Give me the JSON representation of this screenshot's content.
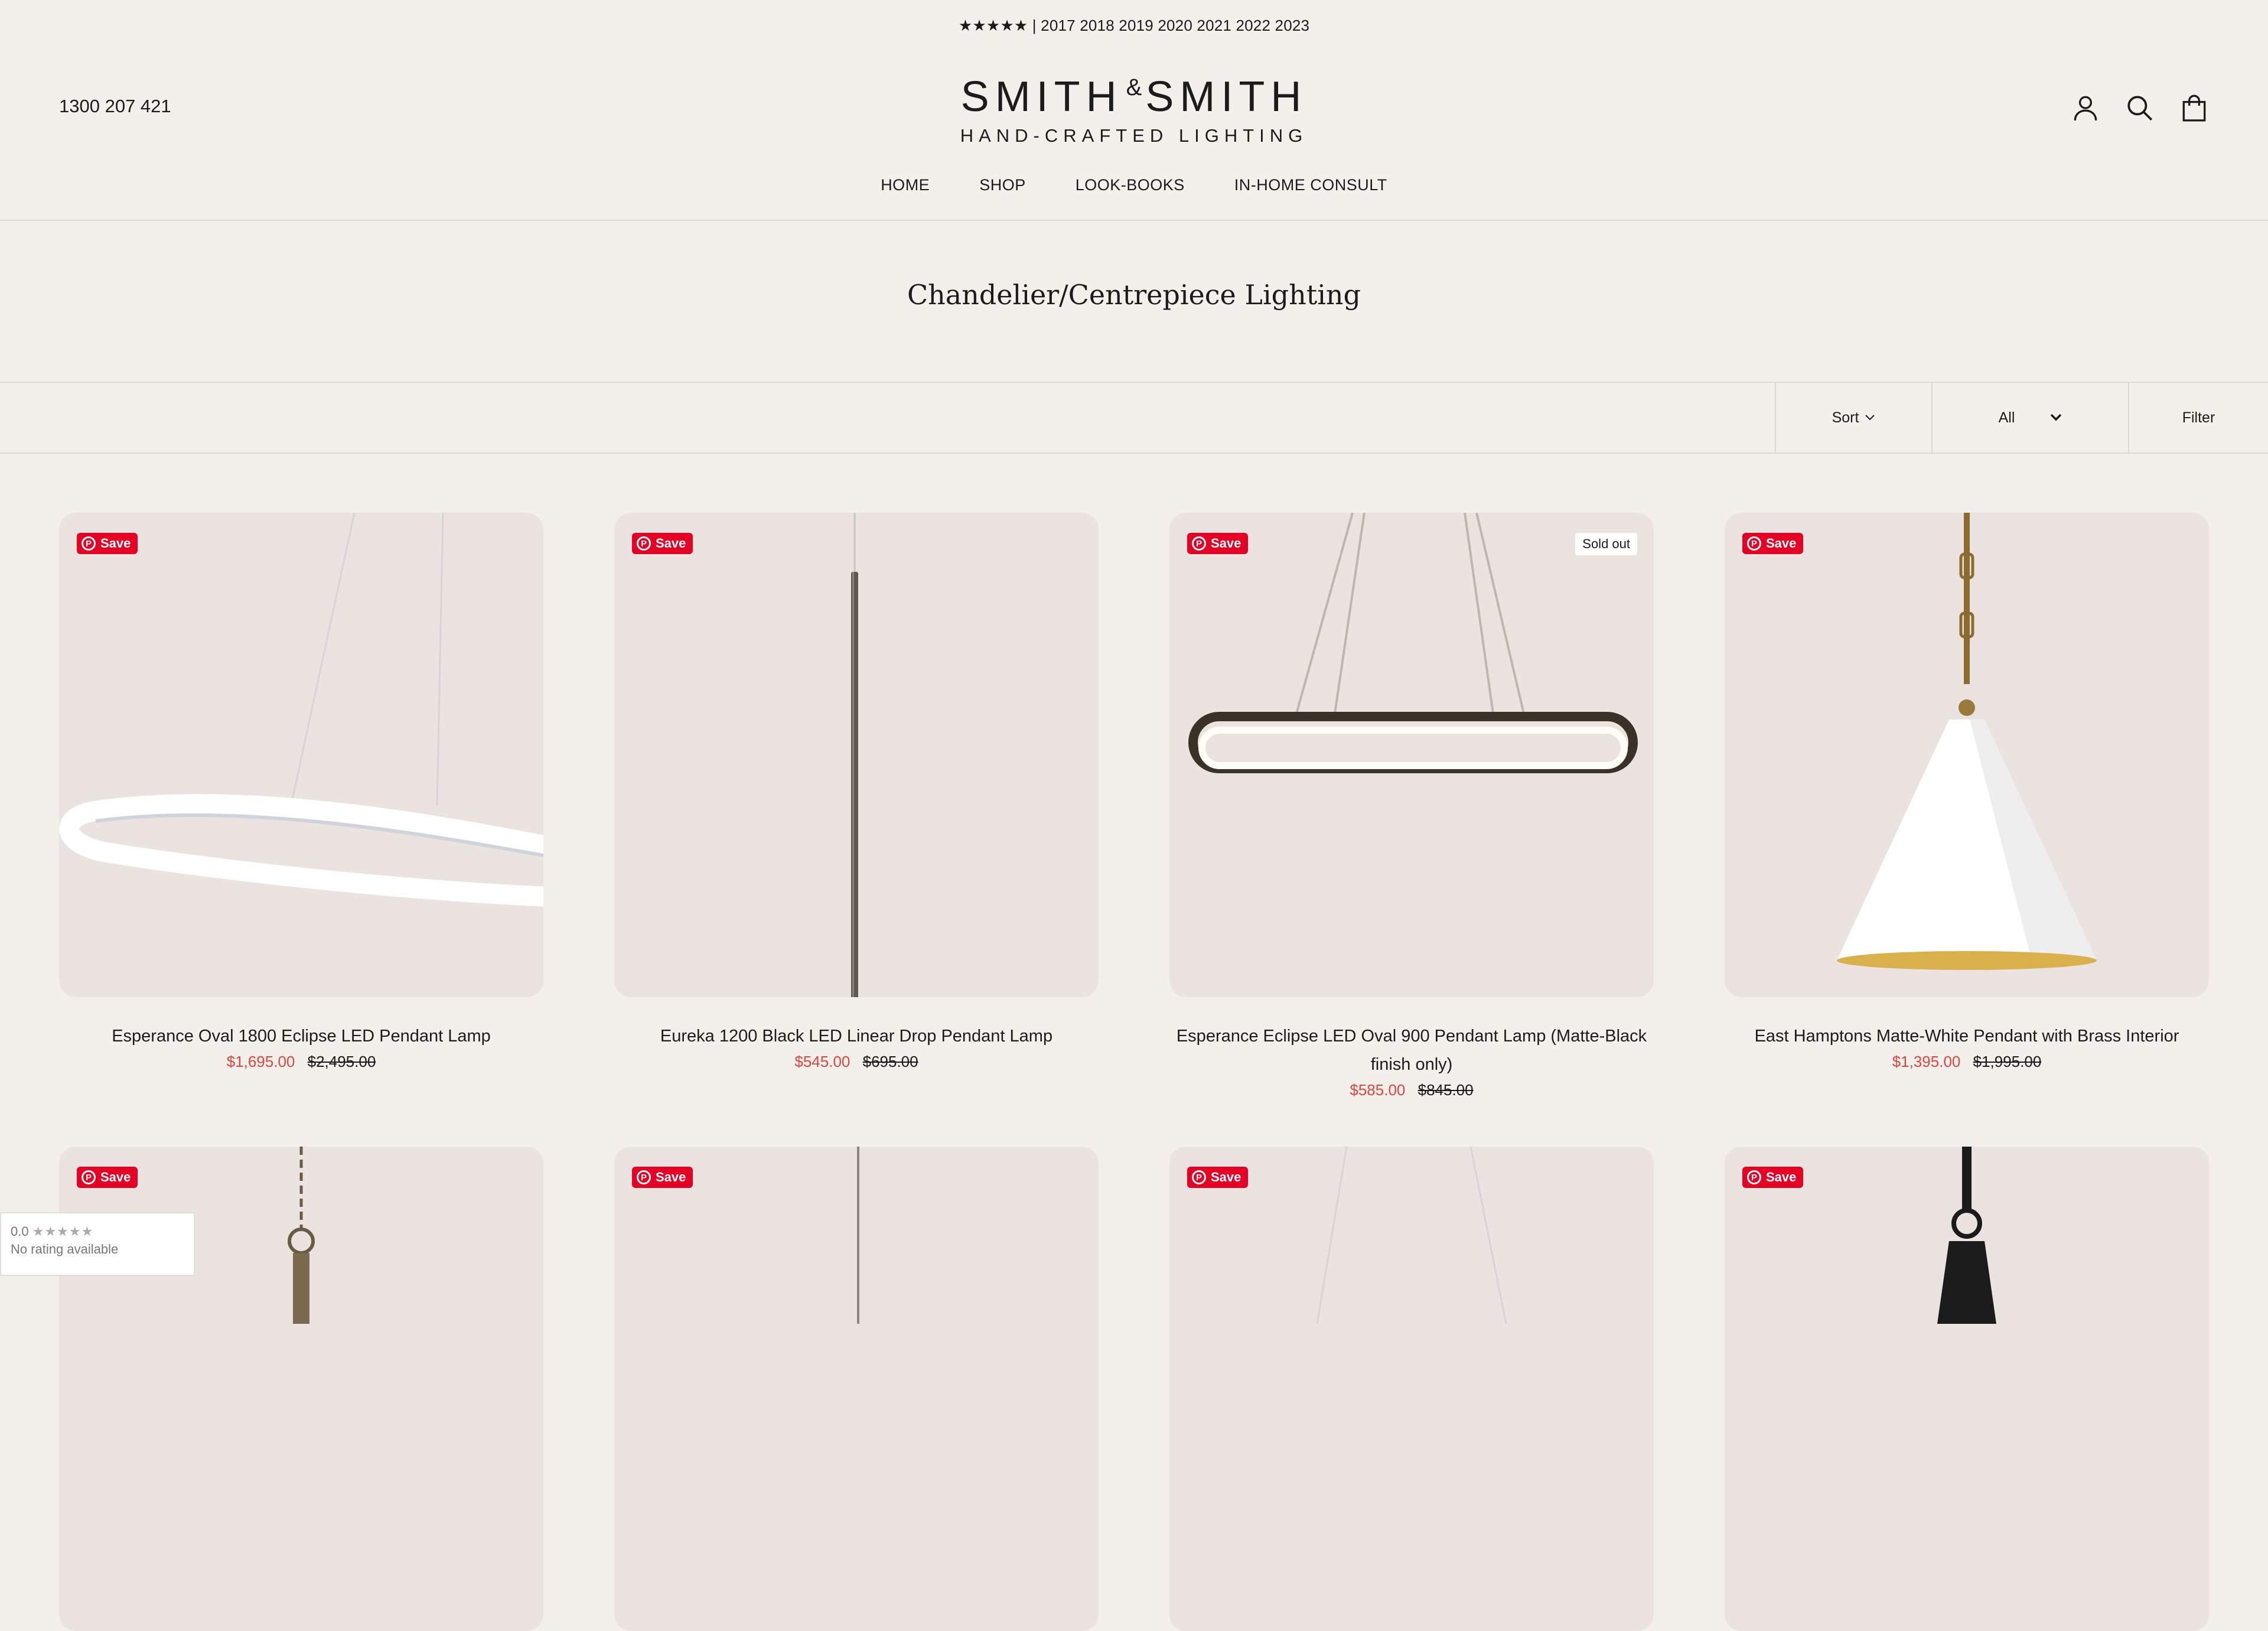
{
  "announcement": "★★★★★ | 2017 2018 2019 2020 2021 2022 2023",
  "header": {
    "phone": "1300 207 421",
    "logo_main_left": "SMITH",
    "logo_amp": "&",
    "logo_main_right": "SMITH",
    "logo_sub": "HAND-CRAFTED LIGHTING",
    "icons": [
      "account-icon",
      "search-icon",
      "cart-icon"
    ]
  },
  "nav": [
    "HOME",
    "SHOP",
    "LOOK-BOOKS",
    "IN-HOME CONSULT"
  ],
  "collection_title": "Chandelier/Centrepiece Lighting",
  "toolbar": {
    "sort_label": "Sort",
    "filter_select": "All",
    "filter_label": "Filter"
  },
  "save_label": "Save",
  "sold_out_label": "Sold out",
  "products": [
    {
      "title": "Esperance Oval 1800 Eclipse LED Pendant Lamp",
      "price": "$1,695.00",
      "compare": "$2,495.00",
      "sold_out": false
    },
    {
      "title": "Eureka 1200 Black LED Linear Drop Pendant Lamp",
      "price": "$545.00",
      "compare": "$695.00",
      "sold_out": false
    },
    {
      "title": "Esperance Eclipse LED Oval 900 Pendant Lamp (Matte-Black finish only)",
      "price": "$585.00",
      "compare": "$845.00",
      "sold_out": true
    },
    {
      "title": "East Hamptons Matte-White Pendant with Brass Interior",
      "price": "$1,395.00",
      "compare": "$1,995.00",
      "sold_out": false
    },
    {
      "title": "",
      "price": "",
      "compare": "",
      "sold_out": false
    },
    {
      "title": "",
      "price": "",
      "compare": "",
      "sold_out": false
    },
    {
      "title": "",
      "price": "",
      "compare": "",
      "sold_out": false
    },
    {
      "title": "",
      "price": "",
      "compare": "",
      "sold_out": false
    }
  ],
  "rating_widget": {
    "score": "0.0",
    "stars": "★★★★★",
    "text": "No rating available"
  },
  "colors": {
    "background": "#f3f0ec",
    "card": "#ebe3e0",
    "sale": "#e0453e",
    "pinterest": "#e60023"
  }
}
